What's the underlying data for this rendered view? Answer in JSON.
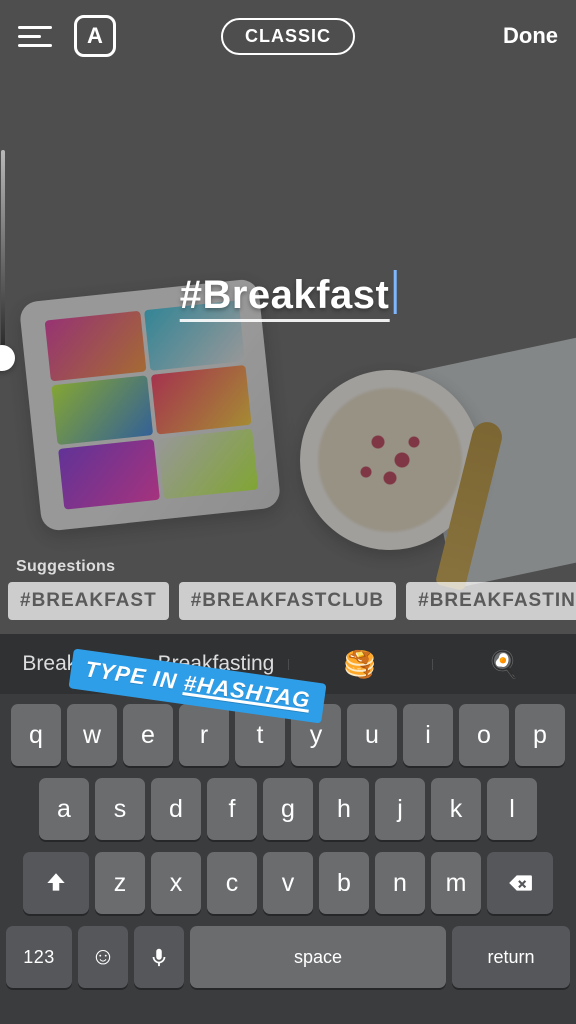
{
  "header": {
    "align_icon": "align",
    "font_glyph": "A",
    "style_label": "CLASSIC",
    "done_label": "Done"
  },
  "typed_text": "#Breakfast",
  "suggestions_label": "Suggestions",
  "suggestions": [
    "#BREAKFAST",
    "#BREAKFASTCLUB",
    "#BREAKFASTINB"
  ],
  "predictive": {
    "word1": "Breakfasts",
    "word2": "Breakfasting",
    "emoji1": "🥞",
    "emoji2": "🍳"
  },
  "annotation_sticker": "TYPE IN #HASHTAG",
  "keyboard": {
    "row1": [
      "q",
      "w",
      "e",
      "r",
      "t",
      "y",
      "u",
      "i",
      "o",
      "p"
    ],
    "row2": [
      "a",
      "s",
      "d",
      "f",
      "g",
      "h",
      "j",
      "k",
      "l"
    ],
    "row3": [
      "z",
      "x",
      "c",
      "v",
      "b",
      "n",
      "m"
    ],
    "numkey": "123",
    "space": "space",
    "return": "return"
  }
}
